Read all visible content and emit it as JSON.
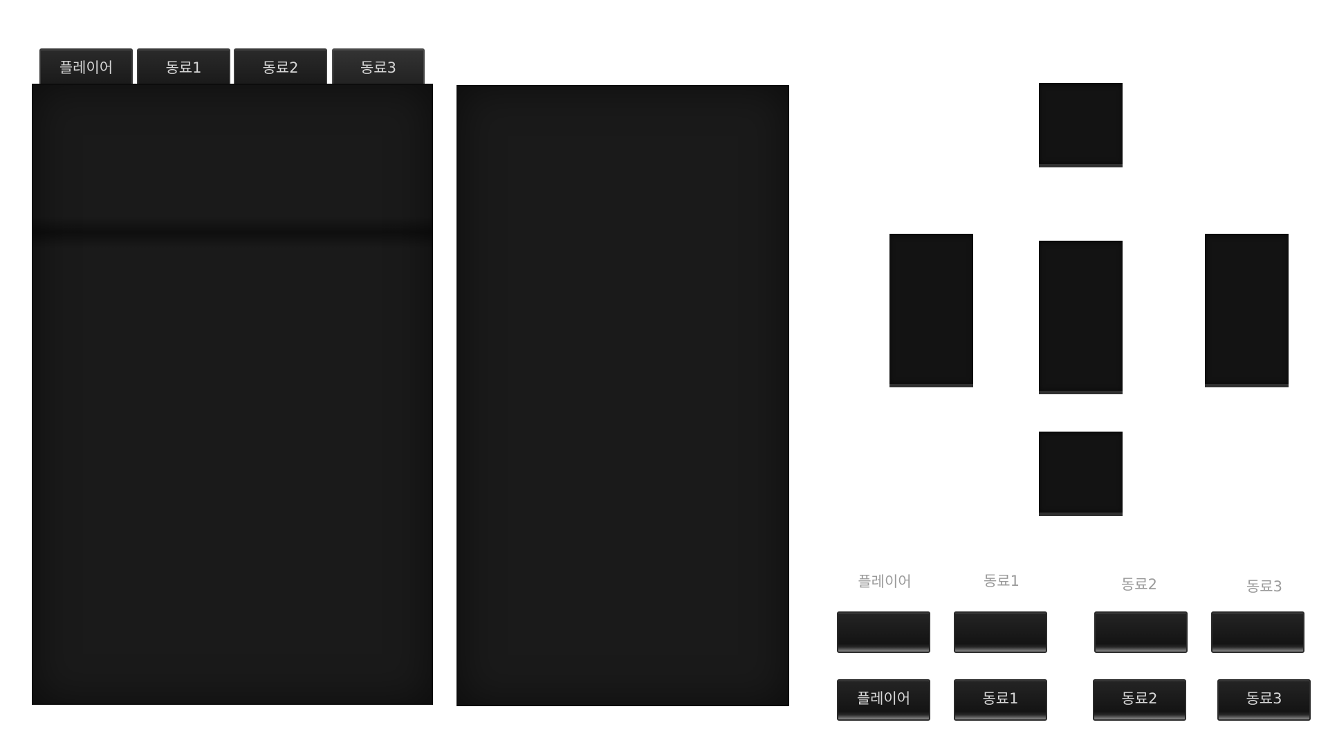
{
  "tabs": [
    {
      "label": "플레이어"
    },
    {
      "label": "동료1"
    },
    {
      "label": "동료2"
    },
    {
      "label": "동료3"
    }
  ],
  "labels": [
    "플레이어",
    "동료1",
    "동료2",
    "동료3"
  ],
  "buttons": [
    {
      "label": "플레이어"
    },
    {
      "label": "동료1"
    },
    {
      "label": "동료2"
    },
    {
      "label": "동료3"
    }
  ]
}
